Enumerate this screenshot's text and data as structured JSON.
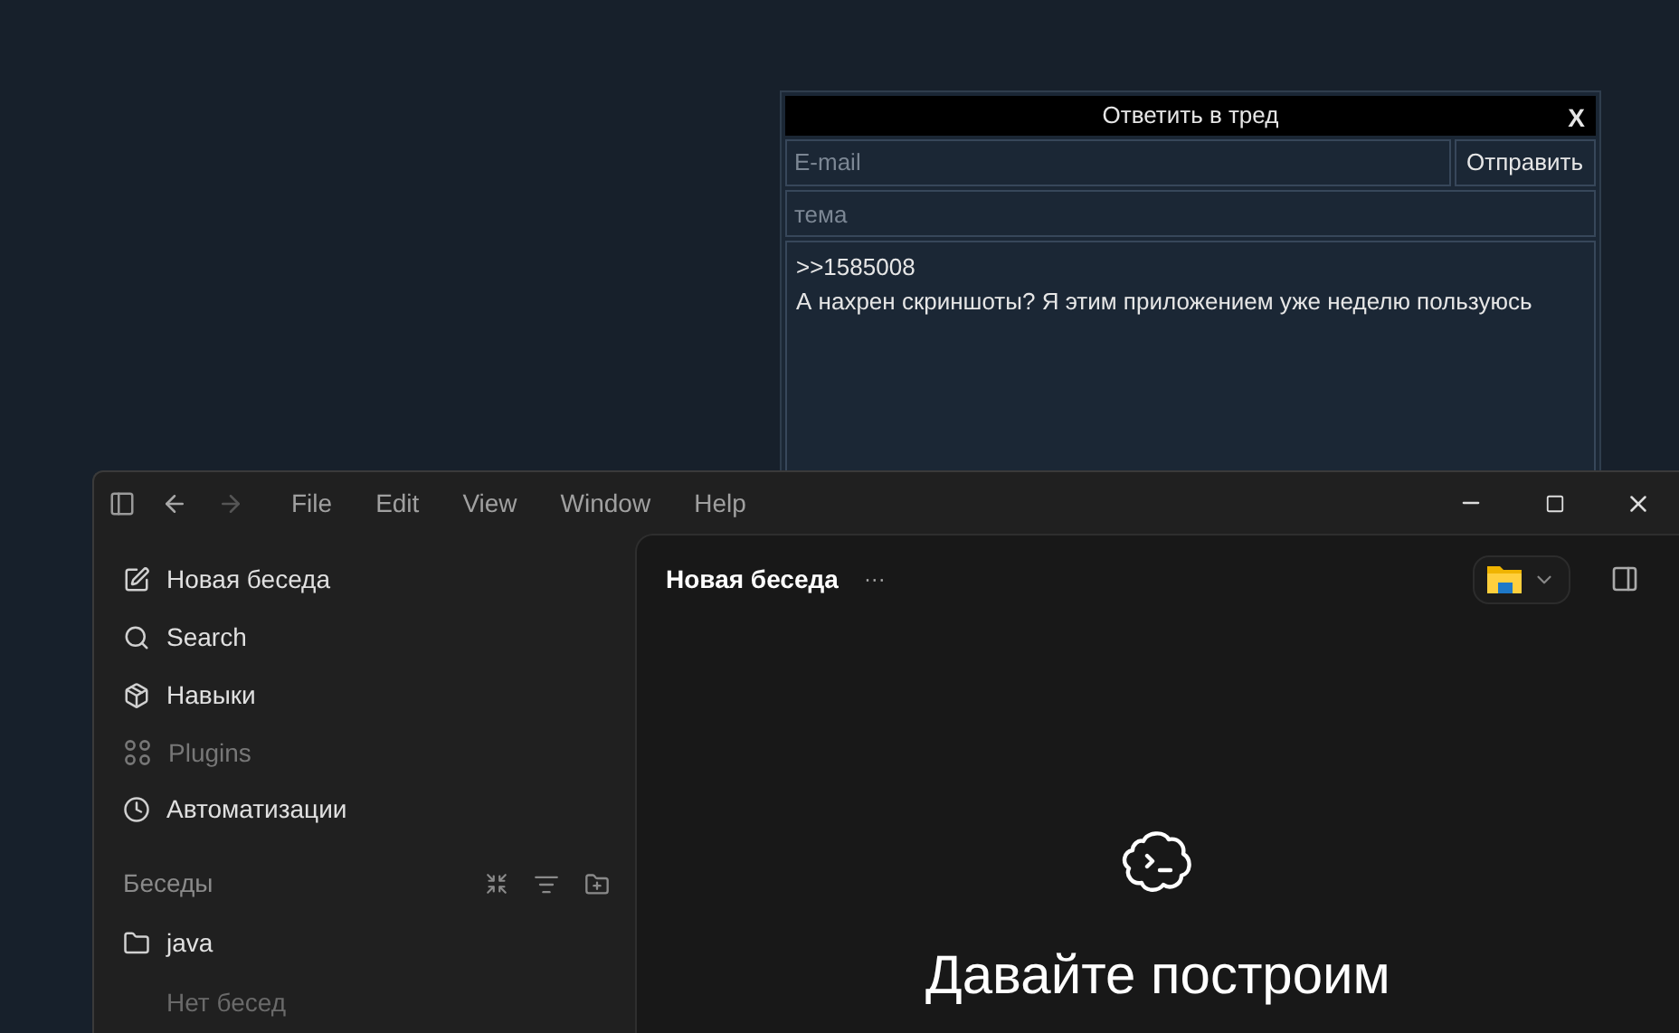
{
  "reply_dialog": {
    "title": "Ответить в тред",
    "close": "X",
    "email_placeholder": "E-mail",
    "send_button": "Отправить",
    "subject_placeholder": "тема",
    "message_lines": [
      ">>1585008",
      "А нахрен скриншоты? Я этим приложением уже неделю пользуюсь"
    ]
  },
  "app_window": {
    "nav": {
      "back_enabled": true,
      "forward_enabled": false
    },
    "menu": [
      "File",
      "Edit",
      "View",
      "Window",
      "Help"
    ],
    "sidebar": {
      "items": [
        {
          "kind": "new",
          "label": "Новая беседа",
          "disabled": false
        },
        {
          "kind": "search",
          "label": "Search",
          "disabled": false
        },
        {
          "kind": "skills",
          "label": "Навыки",
          "disabled": false
        },
        {
          "kind": "plugins",
          "label": "Plugins",
          "disabled": true
        },
        {
          "kind": "automations",
          "label": "Автоматизации",
          "disabled": false
        }
      ],
      "section_title": "Беседы",
      "folders": [
        {
          "name": "java",
          "empty_text": "Нет бесед"
        }
      ]
    },
    "main": {
      "title": "Новая беседа",
      "more": "···",
      "heading": "Давайте построим"
    }
  }
}
